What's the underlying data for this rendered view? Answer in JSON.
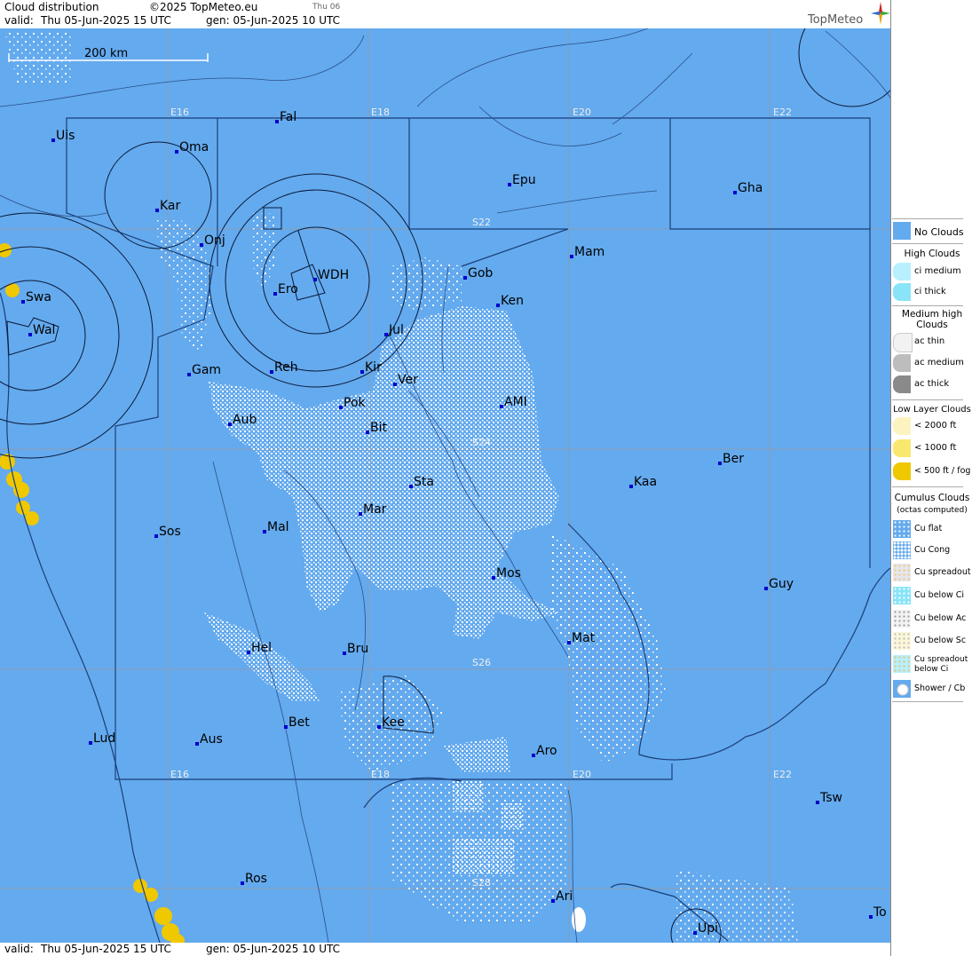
{
  "header": {
    "title": "Cloud distribution",
    "copyright": "©2025 TopMeteo.eu",
    "day": "Thu 06",
    "valid_label": "valid:",
    "valid_value": "Thu  05-Jun-2025  15 UTC",
    "gen": "gen: 05-Jun-2025 10 UTC",
    "brand": "TopMeteo"
  },
  "footer": {
    "valid_label": "valid:",
    "valid_value": "Thu  05-Jun-2025  15 UTC",
    "gen": "gen: 05-Jun-2025 10 UTC"
  },
  "scale_bar": "200 km",
  "grid_labels": {
    "e16_top": "E16",
    "e18_top": "E18",
    "e20_top": "E20",
    "e22_top": "E22",
    "e16_bot": "E16",
    "e18_bot": "E18",
    "e20_bot": "E20",
    "e22_bot": "E22",
    "s22": "S22",
    "s24": "S24",
    "s26": "S26",
    "s28": "S28"
  },
  "cities": {
    "uis": "Uis",
    "fal": "Fal",
    "oma": "Oma",
    "epu": "Epu",
    "gha": "Gha",
    "kar": "Kar",
    "onj": "Onj",
    "swa": "Swa",
    "wal": "Wal",
    "wdh": "WDH",
    "ero": "Ero",
    "gob": "Gob",
    "mam": "Mam",
    "ken": "Ken",
    "jul": "Jul",
    "gam": "Gam",
    "reh": "Reh",
    "kir": "Kir",
    "ver": "Ver",
    "pok": "Pok",
    "ami": "AMI",
    "aub": "Aub",
    "bit": "Bit",
    "ber": "Ber",
    "sta": "Sta",
    "kaa": "Kaa",
    "mar": "Mar",
    "sos": "Sos",
    "mal": "Mal",
    "mos": "Mos",
    "guy": "Guy",
    "mat": "Mat",
    "hel": "Hel",
    "bru": "Bru",
    "bet": "Bet",
    "kee": "Kee",
    "lud": "Lud",
    "aus": "Aus",
    "aro": "Aro",
    "tsw": "Tsw",
    "ros": "Ros",
    "ari": "Ari",
    "upi": "Upi",
    "to": "To"
  },
  "legend": {
    "no_clouds": "No Clouds",
    "high_header": "High Clouds",
    "ci_medium": "ci medium",
    "ci_thick": "ci thick",
    "medium_header": "Medium high Clouds",
    "ac_thin": "ac thin",
    "ac_medium": "ac medium",
    "ac_thick": "ac thick",
    "low_header": "Low Layer Clouds",
    "lt2000": "< 2000 ft",
    "lt1000": "< 1000 ft",
    "lt500": "< 500 ft / fog",
    "cu_header": "Cumulus Clouds",
    "cu_sub": "(octas computed)",
    "cu_flat": "Cu flat",
    "cu_cong": "Cu Cong",
    "cu_spreadout": "Cu spreadout",
    "cu_below_ci": "Cu below Ci",
    "cu_below_ac": "Cu below Ac",
    "cu_below_sc": "Cu below Sc",
    "cu_spreadout_below_ci": "Cu spreadout below Ci",
    "shower_cb": "Shower / Cb"
  },
  "colors": {
    "sea_land_no_cloud": "#64aaee",
    "cloud_cu": "#ffffff",
    "low_fog": "#f0c800",
    "city_marker": "#0000cc"
  }
}
